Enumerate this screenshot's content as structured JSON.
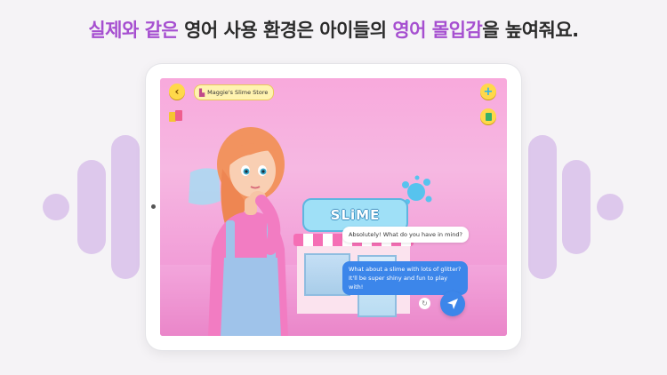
{
  "headline": {
    "part1": "실제와 같은",
    "part2": " 영어 사용 환경은 아이들의 ",
    "part3": "영어 몰입감",
    "part4": "을 높여줘요."
  },
  "app": {
    "store_title": "Maggie's Slime Store",
    "shop_sign": "SLiME",
    "chat": {
      "ai_message": "Absolutely! What do you have in mind?",
      "user_message": "What about a slime with lots of glitter? It'll be super shiny and fun to play with!"
    },
    "icons": {
      "back": "back-arrow-icon",
      "add": "plus-icon",
      "book": "book-icon",
      "retry": "retry-icon",
      "send": "send-paper-plane-icon"
    }
  },
  "colors": {
    "headline_highlight": "#a64fd0",
    "wave": "#ddc8ec",
    "bubble_user": "#3c86ea",
    "buttons": "#ffd84a"
  }
}
